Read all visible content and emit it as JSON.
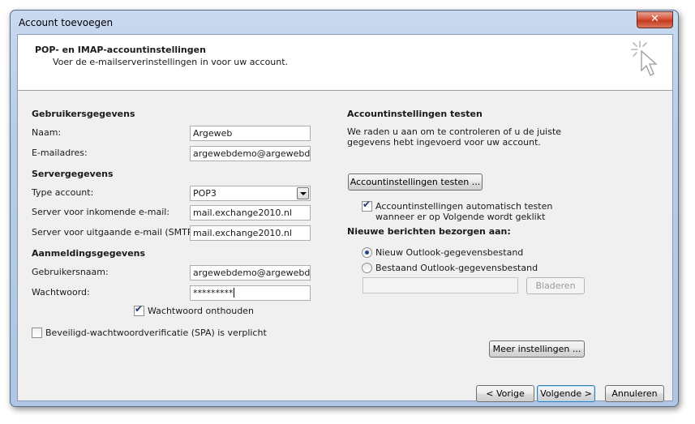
{
  "window": {
    "title": "Account toevoegen",
    "close_glyph": "✕"
  },
  "header": {
    "title": "POP- en IMAP-accountinstellingen",
    "subtitle": "Voer de e-mailserverinstellingen in voor uw account.",
    "icon": "magic-wand-cursor-icon"
  },
  "user_info": {
    "heading": "Gebruikersgegevens",
    "name_label": "Naam:",
    "name_value": "Argeweb",
    "email_label": "E-mailadres:",
    "email_value": "argewebdemo@argewebde"
  },
  "server_info": {
    "heading": "Servergegevens",
    "type_label": "Type account:",
    "type_value": "POP3",
    "incoming_label": "Server voor inkomende e-mail:",
    "incoming_value": "mail.exchange2010.nl",
    "outgoing_label": "Server voor uitgaande e-mail (SMTP):",
    "outgoing_value": "mail.exchange2010.nl"
  },
  "login_info": {
    "heading": "Aanmeldingsgegevens",
    "username_label": "Gebruikersnaam:",
    "username_value": "argewebdemo@argewebde",
    "password_label": "Wachtwoord:",
    "password_value": "*********",
    "remember_label": "Wachtwoord onthouden",
    "remember_checked": true,
    "spa_label": "Beveiligd-wachtwoordverificatie (SPA) is verplicht",
    "spa_checked": false
  },
  "test": {
    "heading": "Accountinstellingen testen",
    "description_line1": "We raden u aan om te controleren of u de juiste",
    "description_line2": "gegevens hebt ingevoerd voor uw account.",
    "button_label": "Accountinstellingen testen ...",
    "auto_line1": "Accountinstellingen automatisch testen",
    "auto_line2": "wanneer er op Volgende wordt geklikt",
    "auto_checked": true
  },
  "delivery": {
    "heading": "Nieuwe berichten bezorgen aan:",
    "option_new": "Nieuw Outlook-gegevensbestand",
    "option_existing": "Bestaand Outlook-gegevensbestand",
    "selected": "new",
    "path_value": "",
    "browse_label": "Bladeren"
  },
  "more_settings_label": "Meer instellingen ...",
  "footer": {
    "back_label": "< Vorige",
    "next_label": "Volgende >",
    "cancel_label": "Annuleren"
  }
}
